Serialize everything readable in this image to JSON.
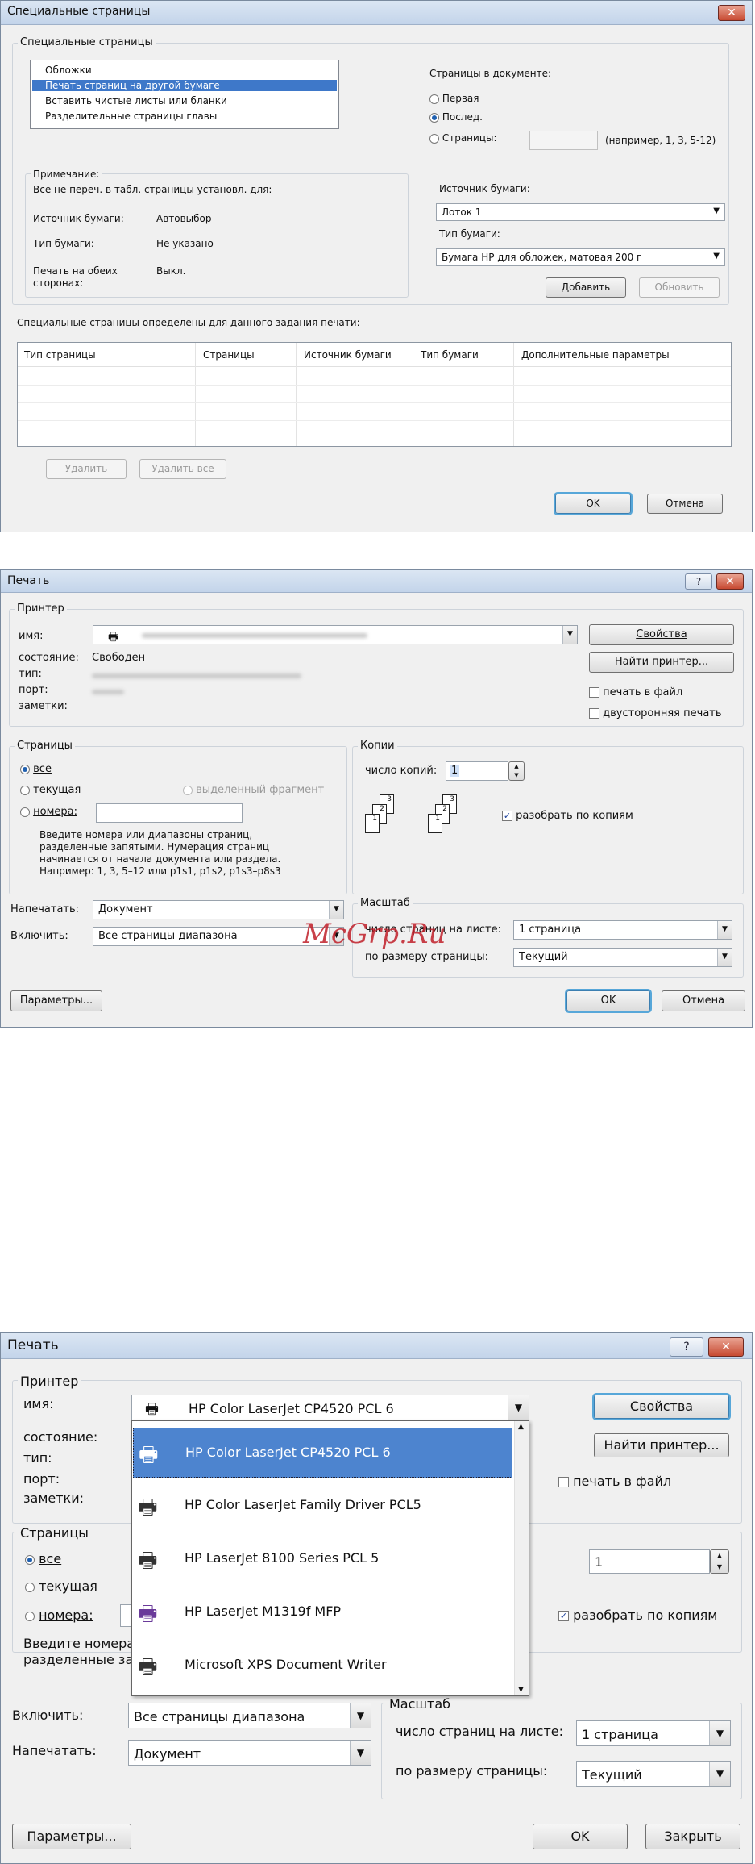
{
  "dialog1": {
    "title": "Специальные страницы",
    "close_label": "✕",
    "group_title": "Специальные страницы",
    "list_items": [
      "Обложки",
      "Печать страниц на другой бумаге",
      "Вставить чистые листы или бланки",
      "Разделительные страницы главы"
    ],
    "pages_in_doc_label": "Страницы в документе:",
    "radio_first": "Первая",
    "radio_last": "Послед.",
    "radio_pages": "Страницы:",
    "pages_hint": "(например, 1, 3, 5-12)",
    "note_title": "Примечание:",
    "note_text": "Все не переч. в  табл. страницы установл. для:",
    "source_label": "Источник бумаги:",
    "source_value": "Автовыбор",
    "type_label": "Тип бумаги:",
    "type_value": "Не указано",
    "duplex_label1": "Печать на обеих",
    "duplex_label2": "сторонах:",
    "duplex_value": "Выкл.",
    "right_source_label": "Источник бумаги:",
    "right_source_value": "Лоток 1",
    "right_type_label": "Тип бумаги:",
    "right_type_value": "Бумага HP для обложек, матовая 200 г",
    "add_btn": "Добавить",
    "update_btn": "Обновить",
    "defined_label": "Специальные страницы определены для данного задания печати:",
    "columns": [
      "Тип страницы",
      "Страницы",
      "Источник бумаги",
      "Тип бумаги",
      "Дополнительные параметры"
    ],
    "delete_btn": "Удалить",
    "delete_all_btn": "Удалить все",
    "ok_btn": "OK",
    "cancel_btn": "Отмена"
  },
  "dialog2": {
    "title": "Печать",
    "help_label": "?",
    "close_label": "✕",
    "printer_group": "Принтер",
    "name_label": "имя:",
    "status_label": "состояние:",
    "status_value": "Свободен",
    "type_label": "тип:",
    "port_label": "порт:",
    "notes_label": "заметки:",
    "properties_btn": "Свойства",
    "find_printer_btn": "Найти принтер...",
    "print_to_file": "печать в файл",
    "duplex": "двусторонняя печать",
    "pages_group": "Страницы",
    "all": "все",
    "current": "текущая",
    "selection": "выделенный фрагмент",
    "numbers": "номера:",
    "help_text": [
      "Введите номера или диапазоны страниц,",
      "разделенные запятыми. Нумерация страниц",
      "начинается от начала документа или раздела.",
      "Например: 1, 3, 5–12 или p1s1, p1s2, p1s3–p8s3"
    ],
    "copies_group": "Копии",
    "copies_label": "число копий:",
    "copies_value": "1",
    "collate": "разобрать по копиям",
    "print_what_label": "Напечатать:",
    "print_what_value": "Документ",
    "include_label": "Включить:",
    "include_value": "Все страницы диапазона",
    "zoom_group": "Масштаб",
    "pages_per_sheet_label": "число страниц на листе:",
    "pages_per_sheet_value": "1 страница",
    "scale_label": "по размеру страницы:",
    "scale_value": "Текущий",
    "options_btn": "Параметры...",
    "ok_btn": "OK",
    "cancel_btn": "Отмена",
    "watermark": "McGrp.Ru"
  },
  "dialog3": {
    "title": "Печать",
    "help_label": "?",
    "close_label": "✕",
    "printer_group": "Принтер",
    "name_label": "имя:",
    "name_value": "HP Color LaserJet CP4520 PCL 6",
    "status_label": "состояние:",
    "type_label": "тип:",
    "port_label": "порт:",
    "notes_label": "заметки:",
    "properties_btn": "Свойства",
    "find_printer_btn": "Найти принтер...",
    "print_to_file": "печать в файл",
    "printers": [
      "HP Color LaserJet CP4520 PCL 6",
      "HP Color LaserJet Family Driver PCL5",
      "HP LaserJet 8100 Series PCL 5",
      "HP LaserJet M1319f MFP",
      "Microsoft XPS Document Writer"
    ],
    "pages_group": "Страницы",
    "all": "все",
    "current": "текущая",
    "numbers": "номера:",
    "help_text": [
      "Введите номера",
      "разделенные за"
    ],
    "copies_value": "1",
    "collate": "разобрать по копиям",
    "include_label": "Включить:",
    "include_value": "Все страницы диапазона",
    "print_what_label": "Напечатать:",
    "print_what_value": "Документ",
    "zoom_group": "Масштаб",
    "pages_per_sheet_label": "число страниц на листе:",
    "pages_per_sheet_value": "1 страница",
    "scale_label": "по размеру страницы:",
    "scale_value": "Текущий",
    "options_btn": "Параметры...",
    "ok_btn": "OK",
    "close_btn": "Закрыть"
  }
}
